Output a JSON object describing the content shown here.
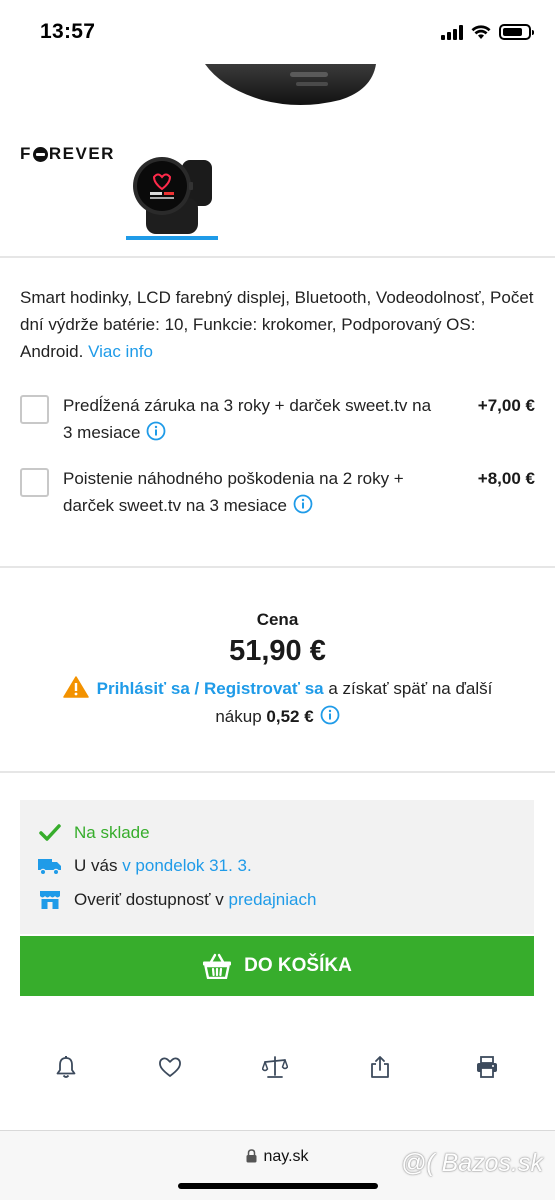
{
  "status_bar": {
    "time": "13:57"
  },
  "brand": {
    "logo_text_left": "F",
    "logo_text_right": "REVER"
  },
  "product": {
    "description": "Smart hodinky, LCD farebný displej, Bluetooth, Vodeodolnosť, Počet dní výdrže batérie: 10, Funkcie: krokomer, Podporovaný OS: Android.",
    "more_info": "Viac info"
  },
  "options": [
    {
      "label": "Predĺžená záruka na 3 roky + darček sweet.tv na 3 mesiace",
      "price": "+7,00 €"
    },
    {
      "label": "Poistenie náhodného poškodenia na 2 roky + darček sweet.tv na 3 mesiace",
      "price": "+8,00 €"
    }
  ],
  "pricing": {
    "label": "Cena",
    "value": "51,90 €",
    "auth_link": "Prihlásiť sa / Registrovať sa",
    "cashback_text": "a získať späť na ďalší nákup",
    "cashback_amount": "0,52 €"
  },
  "availability": {
    "stock": "Na sklade",
    "delivery_prefix": "U vás",
    "delivery_date": "v pondelok 31. 3.",
    "store_prefix": "Overiť dostupnosť v",
    "store_link": "predajniach"
  },
  "cart_button": "DO KOŠÍKA",
  "browser": {
    "url": "nay.sk"
  },
  "watermark": "@( Bazos.sk",
  "colors": {
    "accent_blue": "#1f9be8",
    "green": "#37ad2c",
    "warning": "#f39200"
  }
}
